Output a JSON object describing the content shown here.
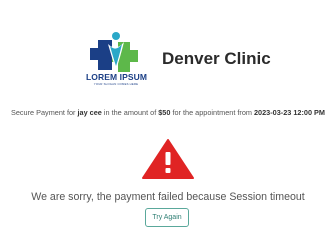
{
  "brand": {
    "logo_text": "LOREM IPSUM",
    "logo_tagline": "YOUR SLOGAN COMES HERE",
    "clinic_name": "Denver Clinic",
    "colors": {
      "blue": "#1b3f86",
      "green": "#5db84a",
      "teal": "#2aa8c8"
    }
  },
  "payment": {
    "prefix": "Secure Payment for ",
    "patient": "jay cee",
    "middle1": " in the amount of ",
    "amount": "$50",
    "middle2": " for the appointment from ",
    "datetime": "2023-03-23 12:00 PM"
  },
  "status": {
    "icon": "warning-icon",
    "icon_color": "#e02424",
    "message": "We are sorry, the payment failed because Session timeout"
  },
  "actions": {
    "retry_label": "Try Again",
    "retry_color": "#2f7f74"
  }
}
